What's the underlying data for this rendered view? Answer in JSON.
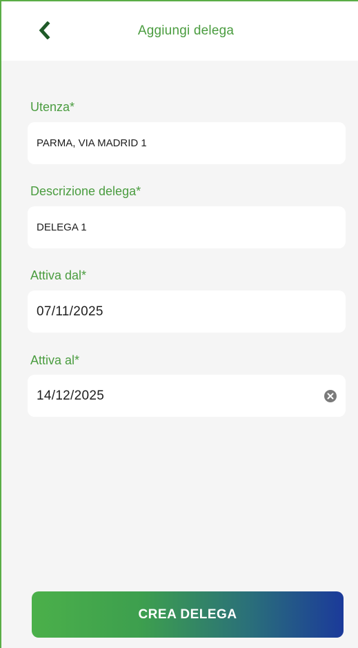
{
  "header": {
    "title": "Aggiungi delega",
    "back_icon": "chevron-left-icon"
  },
  "form": {
    "utenza": {
      "label": "Utenza*",
      "value": "PARMA, VIA MADRID 1"
    },
    "descrizione": {
      "label": "Descrizione delega*",
      "value": "DELEGA 1"
    },
    "attiva_dal": {
      "label": "Attiva dal*",
      "value": "07/11/2025"
    },
    "attiva_al": {
      "label": "Attiva al*",
      "value": "14/12/2025",
      "clear_icon": "clear-circle-icon"
    }
  },
  "actions": {
    "create_label": "CREA DELEGA"
  },
  "colors": {
    "accent": "#4a9c3f",
    "button_gradient_start": "#4bb04a",
    "button_gradient_end": "#1b3a9a",
    "background": "#f5f5f5"
  }
}
